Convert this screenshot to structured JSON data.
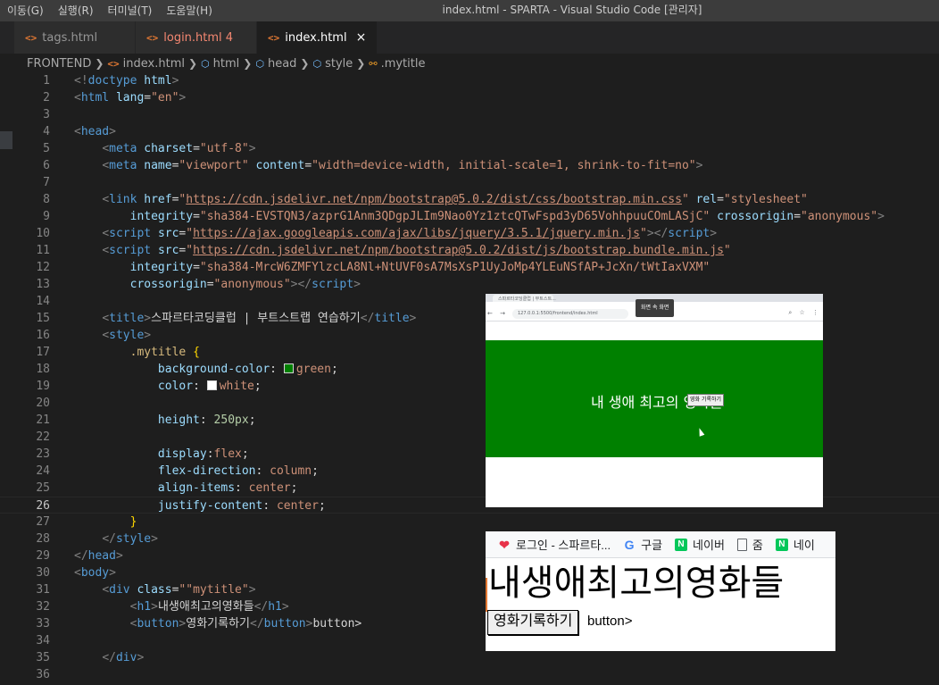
{
  "menu": [
    "이동(G)",
    "실행(R)",
    "터미널(T)",
    "도움말(H)"
  ],
  "window_title": "index.html - SPARTA - Visual Studio Code [관리자]",
  "tabs": [
    {
      "label": "tags.html",
      "icon": "html-file-icon",
      "active": false
    },
    {
      "label": "login.html 4",
      "icon": "html-file-icon",
      "active": false,
      "has_errors": true
    },
    {
      "label": "index.html",
      "icon": "html-file-icon",
      "active": true,
      "close": "×"
    }
  ],
  "breadcrumb": [
    "FRONTEND",
    "index.html",
    "html",
    "head",
    "style",
    ".mytitle"
  ],
  "editor": {
    "current_line": 26,
    "line_numbers": [
      "1",
      "2",
      "3",
      "4",
      "5",
      "6",
      "7",
      "8",
      "9",
      "10",
      "11",
      "12",
      "13",
      "14",
      "15",
      "16",
      "17",
      "18",
      "19",
      "20",
      "21",
      "22",
      "23",
      "24",
      "25",
      "26",
      "27",
      "28",
      "29",
      "30",
      "31",
      "32",
      "33",
      "34",
      "35",
      "36"
    ],
    "lines": {
      "l1_a": "<!",
      "l1_b": "doctype",
      "l1_c": "html",
      "l1_d": ">",
      "l2_a": "<",
      "l2_b": "html",
      "l2_c": "lang",
      "l2_d": "=",
      "l2_e": "\"en\"",
      "l2_f": ">",
      "l4": "head",
      "l5_attr": "charset",
      "l5_val": "\"utf-8\"",
      "l6_attr1": "name",
      "l6_val1": "\"viewport\"",
      "l6_attr2": "content",
      "l6_val2": "\"width=device-width, initial-scale=1, shrink-to-fit=no\"",
      "l8_attr1": "href",
      "l8_url": "https://cdn.jsdelivr.net/npm/bootstrap@5.0.2/dist/css/bootstrap.min.css",
      "l8_attr2": "rel",
      "l8_val2": "\"stylesheet\"",
      "l9_attr1": "integrity",
      "l9_val1": "\"sha384-EVSTQN3/azprG1Anm3QDgpJLIm9Nao0Yz1ztcQTwFspd3yD65VohhpuuCOmLASjC\"",
      "l9_attr2": "crossorigin",
      "l9_val2": "\"anonymous\"",
      "l10_attr": "src",
      "l10_url": "https://ajax.googleapis.com/ajax/libs/jquery/3.5.1/jquery.min.js",
      "l11_attr": "src",
      "l11_url": "https://cdn.jsdelivr.net/npm/bootstrap@5.0.2/dist/js/bootstrap.bundle.min.js",
      "l12_attr": "integrity",
      "l12_val": "\"sha384-MrcW6ZMFYlzcLA8Nl+NtUVF0sA7MsXsP1UyJoMp4YLEuNSfAP+JcXn/tWtIaxVXM\"",
      "l13_attr": "crossorigin",
      "l13_val": "\"anonymous\"",
      "l15_text": "스파르타코딩클럽 | 부트스트랩 연습하기",
      "l16": "style",
      "l17_sel": ".mytitle",
      "l18_prop": "background-color",
      "l18_val": "green",
      "l19_prop": "color",
      "l19_val": "white",
      "l21_prop": "height",
      "l21_val": "250px",
      "l23_prop": "display",
      "l23_val": "flex",
      "l24_prop": "flex-direction",
      "l24_val": "column",
      "l25_prop": "align-items",
      "l25_val": "center",
      "l26_prop": "justify-content",
      "l26_val": "center",
      "l31_attr": "class",
      "l31_val": "\"\"mytitle\"",
      "l32_text": "내생애최고의영화들",
      "l33_text": "영화기록하기",
      "l33_after": "button>",
      "tag_meta": "meta",
      "tag_link": "link",
      "tag_script": "script",
      "tag_title": "title",
      "tag_body": "body",
      "tag_div": "div",
      "tag_h1": "h1",
      "tag_button": "button"
    }
  },
  "colors": {
    "green_swatch": "#008000",
    "white_swatch": "#ffffff",
    "hero_bg": "#008000"
  },
  "preview1": {
    "url": "127.0.0.1:5500/frontend/index.html",
    "tab_title": "스파르타코딩클럽 | 부트스트...",
    "pip_label": "화면 속 화면",
    "heading": "내 생애 최고의 영화들",
    "button": "영화 기록하기"
  },
  "preview2": {
    "bookmarks": [
      {
        "label": "로그인 - 스파르타...",
        "icon": "heart-icon"
      },
      {
        "label": "구글",
        "icon": "google-icon"
      },
      {
        "label": "네이버",
        "icon": "naver-icon"
      },
      {
        "label": "줌",
        "icon": "document-icon"
      },
      {
        "label": "네이",
        "icon": "naver-icon"
      }
    ],
    "heading": "내생애최고의영화들",
    "button": "영화기록하기",
    "trailing_text": "button>"
  }
}
